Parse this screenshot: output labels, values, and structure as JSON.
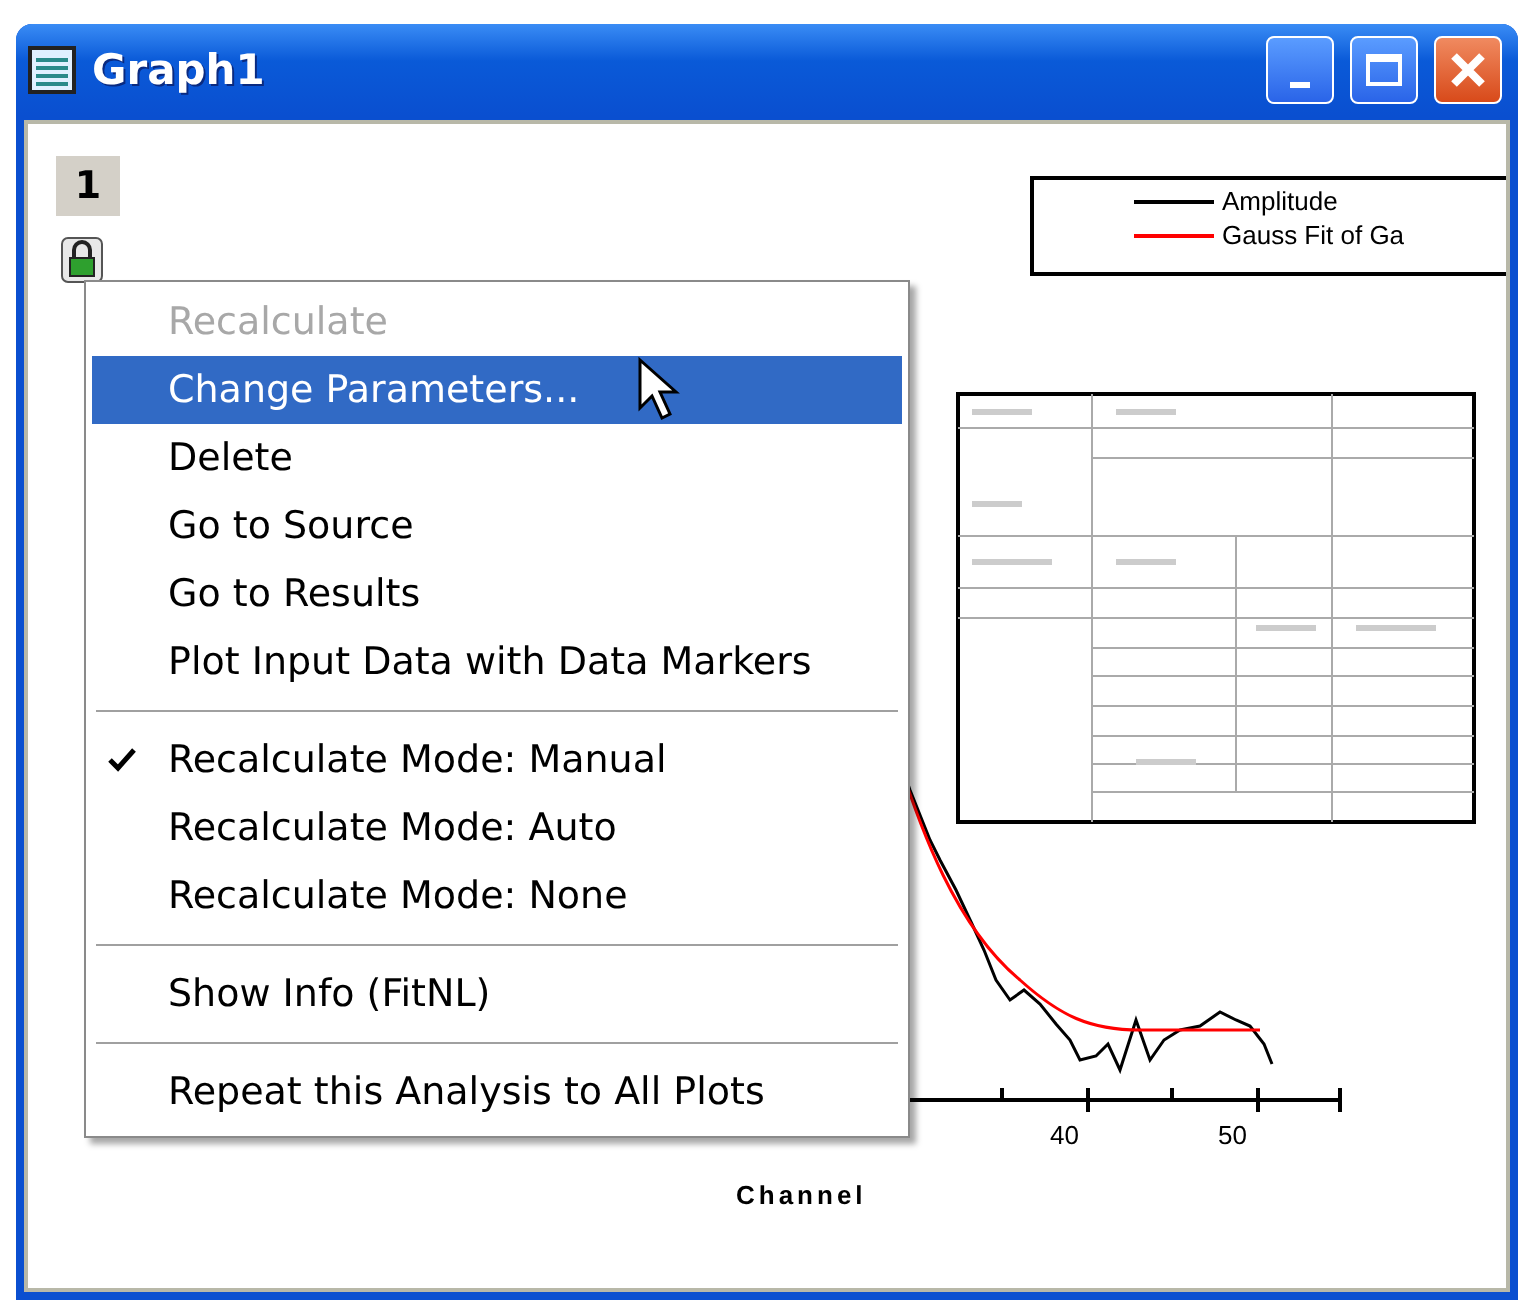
{
  "window": {
    "title": "Graph1",
    "layer_tab": "1"
  },
  "legend": [
    {
      "label": "Amplitude",
      "color": "#000000"
    },
    {
      "label": "Gauss Fit of Ga",
      "color": "#ff0000"
    }
  ],
  "x_axis": {
    "title": "Channel",
    "tick_labels": [
      "40",
      "50"
    ]
  },
  "context_menu": {
    "items": [
      {
        "kind": "item",
        "label": "Recalculate",
        "disabled": true,
        "selected": false,
        "checked": false
      },
      {
        "kind": "item",
        "label": "Change Parameters...",
        "disabled": false,
        "selected": true,
        "checked": false
      },
      {
        "kind": "item",
        "label": "Delete",
        "disabled": false,
        "selected": false,
        "checked": false
      },
      {
        "kind": "item",
        "label": "Go to Source",
        "disabled": false,
        "selected": false,
        "checked": false
      },
      {
        "kind": "item",
        "label": "Go to Results",
        "disabled": false,
        "selected": false,
        "checked": false
      },
      {
        "kind": "item",
        "label": "Plot Input Data with Data Markers",
        "disabled": false,
        "selected": false,
        "checked": false
      },
      {
        "kind": "separator"
      },
      {
        "kind": "item",
        "label": "Recalculate Mode: Manual",
        "disabled": false,
        "selected": false,
        "checked": true
      },
      {
        "kind": "item",
        "label": "Recalculate Mode: Auto",
        "disabled": false,
        "selected": false,
        "checked": false
      },
      {
        "kind": "item",
        "label": "Recalculate Mode: None",
        "disabled": false,
        "selected": false,
        "checked": false
      },
      {
        "kind": "separator"
      },
      {
        "kind": "item",
        "label": "Show Info (FitNL)",
        "disabled": false,
        "selected": false,
        "checked": false
      },
      {
        "kind": "separator"
      },
      {
        "kind": "item",
        "label": "Repeat this Analysis to All Plots",
        "disabled": false,
        "selected": false,
        "checked": false
      }
    ]
  }
}
